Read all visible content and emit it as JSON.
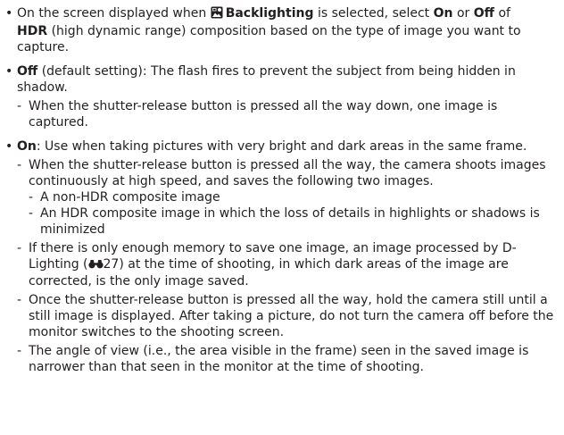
{
  "doc": {
    "intro_pre": "On the screen displayed when",
    "intro_icon": "backlighting-scene-icon",
    "intro_backlighting": "Backlighting",
    "intro_mid1": "is selected, select",
    "intro_on": "On",
    "intro_or": "or",
    "intro_off": "Off",
    "intro_of": "of",
    "intro_hdr": "HDR",
    "intro_post": "(high dynamic range) composition based on the type of image you want to capture.",
    "off_label": "Off",
    "off_text": "(default setting): The flash fires to prevent the subject from being hidden in shadow.",
    "off_sub1": "When the shutter-release button is pressed all the way down, one image is captured.",
    "on_label": "On",
    "on_text": ": Use when taking pictures with very bright and dark areas in the same frame.",
    "on_sub1": "When the shutter-release button is pressed all the way, the camera shoots images continuously at high speed, and saves the following two images.",
    "on_sub1_a": "A non-HDR composite image",
    "on_sub1_b": "An HDR composite image in which the loss of details in highlights or shadows is minimized",
    "on_sub2_pre": "If there is only enough memory to save one image, an image processed by D-Lighting (",
    "on_sub2_ref_icon": "binoculars-reference-icon",
    "on_sub2_ref": "27",
    "on_sub2_post": ") at the time of shooting, in which dark areas of the image are corrected, is the only image saved.",
    "on_sub3": "Once the shutter-release button is pressed all the way, hold the camera still until a still image is displayed. After taking a picture, do not turn the camera off before the monitor switches to the shooting screen.",
    "on_sub4": "The angle of view (i.e., the area visible in the frame) seen in the saved image is narrower than that seen in the monitor at the time of shooting.",
    "bullet_char": "•",
    "dash_char": "-"
  }
}
